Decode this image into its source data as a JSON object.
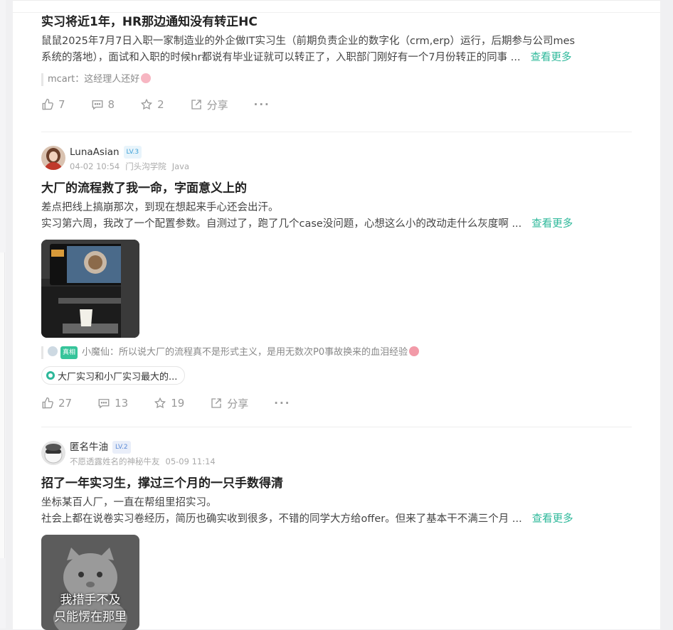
{
  "posts": [
    {
      "title": "实习将近1年，HR那边通知没有转正HC",
      "body_lines": [
        "鼠鼠2025年7月7日入职一家制造业的外企做IT实习生（前期负责企业的数字化（crm,erp）运行，后期参与公司mes",
        "系统的落地），面试和入职的时候hr都说有毕业证就可以转正了，入职部门刚好有一个7月份转正的同事 ..."
      ],
      "more_label": "查看更多",
      "comment_preview": "mcart：这经理人还好",
      "likes": "7",
      "comments": "8",
      "stars": "2",
      "share_label": "分享",
      "more_dots": "···"
    },
    {
      "user": {
        "name": "LunaAsian",
        "level": "LV.3",
        "date": "04-02 10:54",
        "org": "门头沟学院",
        "field": "Java"
      },
      "title": "大厂的流程救了我一命，字面意义上的",
      "body_lines": [
        "差点把线上搞崩那次，到现在想起来手心还会出汗。",
        "实习第六周，我改了一个配置参数。自测过了，跑了几个case没问题，心想这么小的改动走什么灰度啊 ..."
      ],
      "more_label": "查看更多",
      "comment_badge": "真相",
      "comment_preview": "小魔仙：所以说大厂的流程真不是形式主义，是用无数次P0事故换来的血泪经验",
      "topic": "大厂实习和小厂实习最大的...",
      "likes": "27",
      "comments": "13",
      "stars": "19",
      "share_label": "分享",
      "more_dots": "···"
    },
    {
      "user": {
        "name": "匿名牛油",
        "level": "LV.2",
        "subtitle": "不愿透露姓名的神秘牛友",
        "date": "05-09 11:14"
      },
      "title": "招了一年实习生，撑过三个月的一只手数得清",
      "body_lines": [
        "坐标某百人厂，一直在帮组里招实习。",
        "社会上都在说卷实习卷经历，简历也确实收到很多，不错的同学大方给offer。但来了基本干不满三个月 ..."
      ],
      "more_label": "查看更多",
      "image_caption_lines": [
        "我措手不及",
        "只能愣在那里"
      ]
    }
  ],
  "colors": {
    "accent": "#2db89a",
    "muted": "#999999"
  }
}
